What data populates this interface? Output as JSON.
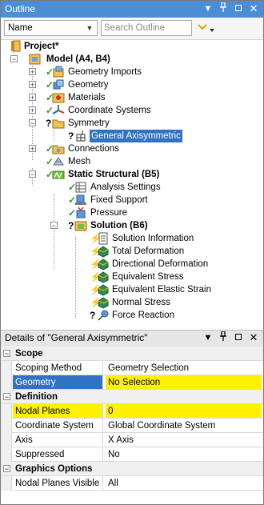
{
  "outline": {
    "title": "Outline",
    "combo_value": "Name",
    "search_placeholder": "Search Outline",
    "tree": {
      "project": "Project*",
      "model": "Model (A4, B4)",
      "geometry_imports": "Geometry Imports",
      "geometry": "Geometry",
      "materials": "Materials",
      "coordinate_systems": "Coordinate Systems",
      "symmetry": "Symmetry",
      "general_axisymmetric": "General Axisymmetric",
      "connections": "Connections",
      "mesh": "Mesh",
      "static_structural": "Static Structural (B5)",
      "analysis_settings": "Analysis Settings",
      "fixed_support": "Fixed Support",
      "pressure": "Pressure",
      "solution": "Solution (B6)",
      "solution_information": "Solution Information",
      "total_deformation": "Total Deformation",
      "directional_deformation": "Directional Deformation",
      "equivalent_stress": "Equivalent Stress",
      "equivalent_elastic_strain": "Equivalent Elastic Strain",
      "normal_stress": "Normal Stress",
      "force_reaction": "Force Reaction"
    }
  },
  "details": {
    "title": "Details of \"General Axisymmetric\"",
    "groups": {
      "scope": "Scope",
      "definition": "Definition",
      "graphics_options": "Graphics Options"
    },
    "rows": {
      "scoping_method": {
        "key": "Scoping Method",
        "value": "Geometry Selection"
      },
      "geometry": {
        "key": "Geometry",
        "value": "No Selection"
      },
      "nodal_planes": {
        "key": "Nodal Planes",
        "value": "0"
      },
      "coordinate_system": {
        "key": "Coordinate System",
        "value": "Global Coordinate System"
      },
      "axis": {
        "key": "Axis",
        "value": "X Axis"
      },
      "suppressed": {
        "key": "Suppressed",
        "value": "No"
      },
      "nodal_planes_visible": {
        "key": "Nodal Planes Visible",
        "value": "All"
      }
    }
  },
  "icons": {
    "pin": "pin-icon",
    "maximize": "maximize-icon",
    "close": "close-icon",
    "filter": "filter-icon"
  },
  "colors": {
    "active_titlebar": "#4b8ed6",
    "selection": "#3073c4",
    "required_field": "#fff200",
    "check_green": "#2f9a2f",
    "question_black": "#000000",
    "lightning_yellow": "#f2c200"
  },
  "tree_state": {
    "selected": "General Axisymmetric"
  }
}
